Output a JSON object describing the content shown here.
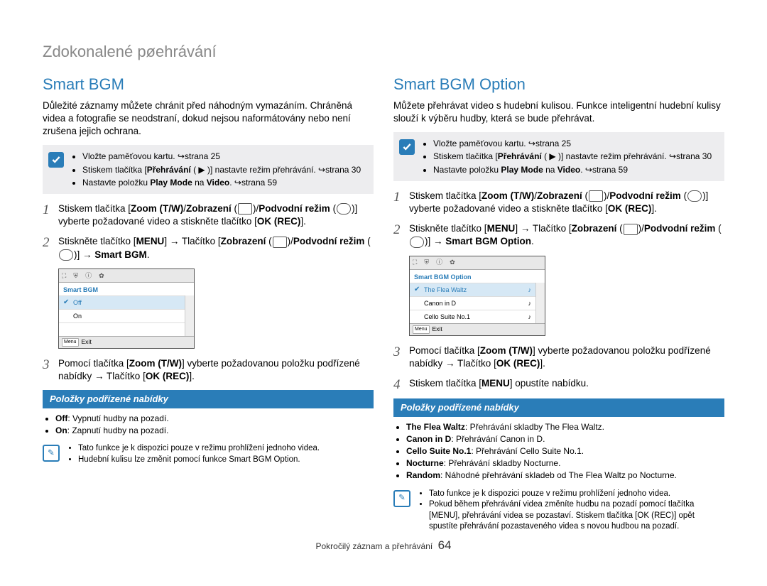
{
  "page_title": "Zdokonalené pøehrávání",
  "footer": {
    "text": "Pokročilý záznam a přehrávání",
    "page": "64"
  },
  "left": {
    "heading": "Smart BGM",
    "intro": "Důležité záznamy můžete chránit před náhodným vymazáním. Chráněná videa a fotografie se neodstraní, dokud nejsou naformátovány nebo není zrušena jejich ochrana.",
    "note": [
      {
        "pre": "Vložte paměťovou kartu. ",
        "link": "↪strana 25"
      },
      {
        "pre": "Stiskem tlačítka [",
        "b": "Přehrávání",
        "post": " ( ▶ )] nastavte režim přehrávání. ",
        "link": "↪strana 30"
      },
      {
        "pre": "Nastavte položku ",
        "b": "Play Mode",
        "post": " na ",
        "b2": "Video",
        "post2": ". ",
        "link": "↪strana 59"
      }
    ],
    "step1": {
      "p1": "Stiskem tlačítka [",
      "b1": "Zoom (T/W)",
      "s1": "/",
      "b2": "Zobrazení",
      "s2": " (",
      "s3": ")/",
      "b3": "Podvodní režim",
      "s4": " (",
      "s5": ")] vyberte požadované video a stiskněte tlačítko [",
      "b4": "OK (REC)",
      "s6": "]."
    },
    "step2": {
      "p1": "Stiskněte tlačítko [",
      "b1": "MENU",
      "s1": "] ",
      "ar1": "→",
      "s2": " Tlačítko [",
      "b2": "Zobrazení",
      "s3": " (",
      "s4": ")/",
      "b3": "Podvodní režim",
      "s5": " (",
      "s6": ")] ",
      "ar2": "→",
      "s7": " ",
      "b4": "Smart BGM",
      "s8": "."
    },
    "screenshot": {
      "title": "Smart BGM",
      "rows": [
        "Off",
        "On"
      ],
      "menu": "Menu",
      "exit": "Exit"
    },
    "step3": {
      "p1": "Pomocí tlačítka [",
      "b1": "Zoom (T/W)",
      "s1": "] vyberte požadovanou položku podřízené nabídky ",
      "ar": "→",
      "s2": " Tlačítko [",
      "b2": "OK (REC)",
      "s3": "]."
    },
    "submenu_title": "Položky podřízené nabídky",
    "submenu": [
      {
        "b": "Off",
        "t": ": Vypnutí hudby na pozadí."
      },
      {
        "b": "On",
        "t": ": Zapnutí hudby na pozadí."
      }
    ],
    "tips": [
      "Tato funkce je k dispozici pouze v režimu prohlížení jednoho videa.",
      "Hudební kulisu lze změnit pomocí funkce Smart BGM Option."
    ]
  },
  "right": {
    "heading": "Smart BGM Option",
    "intro": "Můžete přehrávat video s hudební kulisou. Funkce inteligentní hudební kulisy slouží k výběru hudby, která se bude přehrávat.",
    "note": [
      {
        "pre": "Vložte paměťovou kartu. ",
        "link": "↪strana 25"
      },
      {
        "pre": "Stiskem tlačítka [",
        "b": "Přehrávání",
        "post": " ( ▶ )] nastavte režim přehrávání. ",
        "link": "↪strana 30"
      },
      {
        "pre": "Nastavte položku ",
        "b": "Play Mode",
        "post": " na ",
        "b2": "Video",
        "post2": ". ",
        "link": "↪strana 59"
      }
    ],
    "step1": {
      "p1": "Stiskem tlačítka [",
      "b1": "Zoom (T/W)",
      "s1": "/",
      "b2": "Zobrazení",
      "s2": " (",
      "s3": ")/",
      "b3": "Podvodní režim",
      "s4": " (",
      "s5": ")] vyberte požadované video a stiskněte tlačítko [",
      "b4": "OK (REC)",
      "s6": "]."
    },
    "step2": {
      "p1": "Stiskněte tlačítko [",
      "b1": "MENU",
      "s1": "] ",
      "ar1": "→",
      "s2": " Tlačítko [",
      "b2": "Zobrazení",
      "s3": " (",
      "s4": ")/",
      "b3": "Podvodní režim",
      "s5": " (",
      "s6": ")] ",
      "ar2": "→",
      "s7": " ",
      "b4": "Smart BGM Option",
      "s8": "."
    },
    "screenshot": {
      "title": "Smart BGM Option",
      "rows": [
        "The Flea Waltz",
        "Canon in D",
        "Cello Suite No.1"
      ],
      "menu": "Menu",
      "exit": "Exit"
    },
    "step3": {
      "p1": "Pomocí tlačítka [",
      "b1": "Zoom (T/W)",
      "s1": "] vyberte požadovanou položku podřízené nabídky ",
      "ar": "→",
      "s2": " Tlačítko [",
      "b2": "OK (REC)",
      "s3": "]."
    },
    "step4": {
      "p1": "Stiskem tlačítka [",
      "b1": "MENU",
      "s1": "] opustíte nabídku."
    },
    "submenu_title": "Položky podřízené nabídky",
    "submenu": [
      {
        "b": "The Flea Waltz",
        "t": ": Přehrávání skladby The Flea Waltz."
      },
      {
        "b": "Canon in D",
        "t": ": Přehrávání Canon in D."
      },
      {
        "b": "Cello Suite No.1",
        "t": ": Přehrávání Cello Suite No.1."
      },
      {
        "b": "Nocturne",
        "t": ": Přehrávání skladby Nocturne."
      },
      {
        "b": "Random",
        "t": ": Náhodné přehrávání skladeb od The Flea Waltz po Nocturne."
      }
    ],
    "tips": [
      "Tato funkce je k dispozici pouze v režimu prohlížení jednoho videa.",
      "Pokud během přehrávání videa změníte hudbu na pozadí pomocí tlačítka [MENU], přehrávání videa se pozastaví. Stiskem tlačítka [OK (REC)] opět spustíte přehrávání pozastaveného videa s novou hudbou na pozadí."
    ]
  }
}
